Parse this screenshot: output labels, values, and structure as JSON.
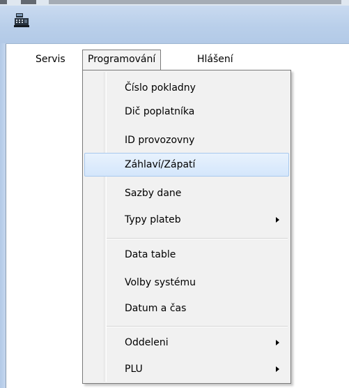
{
  "menubar": {
    "items": [
      {
        "label": "Servis"
      },
      {
        "label": "Programování"
      },
      {
        "label": "Hlášení"
      }
    ]
  },
  "dropdown": {
    "items": [
      {
        "label": "Číslo pokladny"
      },
      {
        "label": "Dič poplatníka"
      },
      {
        "label": "ID provozovny"
      },
      {
        "label": "Záhlaví/Zápatí"
      },
      {
        "label": "Sazby dane"
      },
      {
        "label": "Typy plateb"
      },
      {
        "label": "Data table"
      },
      {
        "label": "Volby systému"
      },
      {
        "label": "Datum a čas"
      },
      {
        "label": "Oddeleni"
      },
      {
        "label": "PLU"
      }
    ]
  },
  "icons": {
    "app": "cash-register-icon",
    "submenu": "submenu-arrow-icon"
  },
  "colors": {
    "title_bar": "#b9cfea",
    "menu_bg": "#f1f1f1",
    "hover_bg": "#d4e6fb",
    "hover_border": "#a8c9ee"
  }
}
